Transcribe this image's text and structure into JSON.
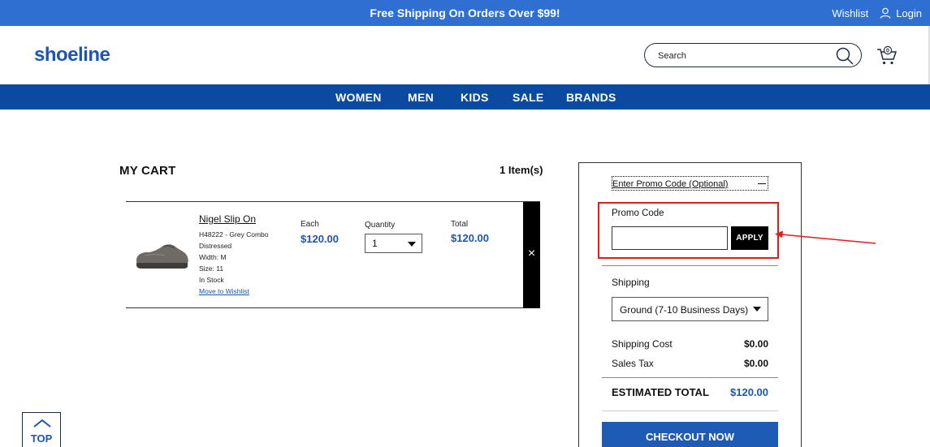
{
  "topbar": {
    "promo_text": "Free Shipping On Orders Over $99!",
    "wishlist_label": "Wishlist",
    "login_label": "Login"
  },
  "header": {
    "logo_text": "shoeline",
    "search_placeholder": "Search",
    "cart_count": "0"
  },
  "nav": {
    "items": [
      "WOMEN",
      "MEN",
      "KIDS",
      "SALE",
      "BRANDS"
    ]
  },
  "cart": {
    "title": "MY CART",
    "item_count": "1 Item(s)",
    "items": [
      {
        "name": "Nigel Slip On",
        "sku_color": "H48222 - Grey Combo Distressed",
        "width": "Width: M",
        "size": "Size: 11",
        "stock": "In Stock",
        "move_to_wishlist": "Move to Wishlist",
        "each_label": "Each",
        "each_price": "$120.00",
        "qty_label": "Quantity",
        "qty_value": "1",
        "total_label": "Total",
        "total_price": "$120.00",
        "remove_glyph": "×"
      }
    ]
  },
  "summary": {
    "promo_toggle_label": "Enter Promo Code (Optional)",
    "promo_label": "Promo Code",
    "promo_value": "",
    "apply_label": "APPLY",
    "shipping_label": "Shipping",
    "shipping_selected": "Ground (7-10 Business Days)",
    "shipping_cost_label": "Shipping Cost",
    "shipping_cost_value": "$0.00",
    "sales_tax_label": "Sales Tax",
    "sales_tax_value": "$0.00",
    "estimated_total_label": "ESTIMATED TOTAL",
    "estimated_total_value": "$120.00",
    "checkout_label": "CHECKOUT NOW"
  },
  "top_button": {
    "label": "TOP"
  },
  "colors": {
    "topbar": "#2e6fd1",
    "nav": "#0b4aa1",
    "brand_blue": "#1e55b0",
    "checkout": "#1e5bb4",
    "annotation_red": "#e21c1c"
  }
}
